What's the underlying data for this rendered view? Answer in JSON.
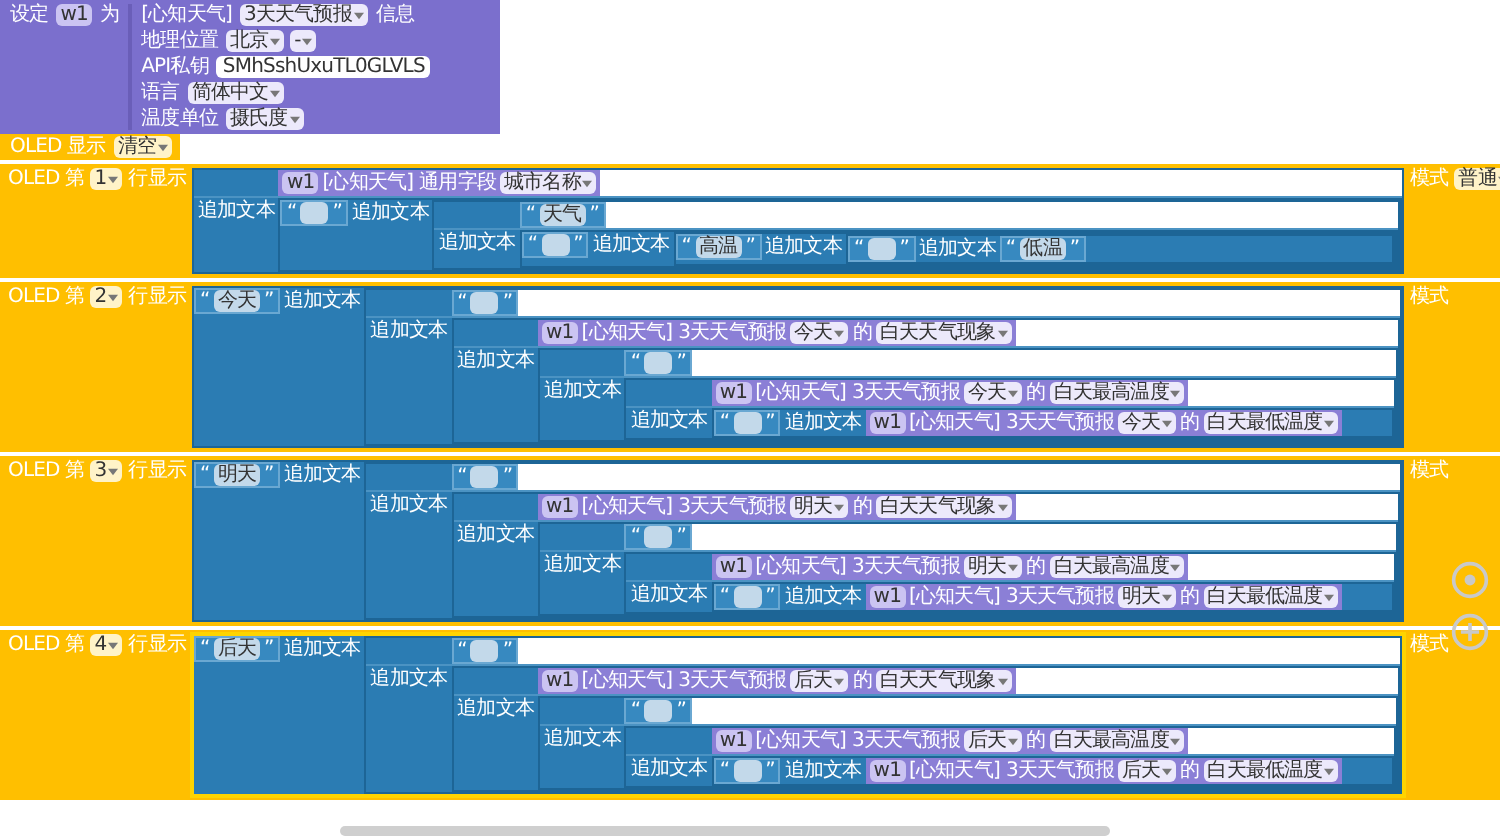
{
  "settings": {
    "set": "设定",
    "var": "w1",
    "as": "为",
    "source": "[心知天气]",
    "name": "3天天气预报",
    "info": "信息",
    "rows": [
      {
        "label": "地理位置",
        "dropdowns": [
          "北京",
          "-"
        ]
      },
      {
        "label": "API私钥",
        "field": "SMhSshUxuTL0GLVLS"
      },
      {
        "label": "语言",
        "dropdowns": [
          "简体中文"
        ]
      },
      {
        "label": "温度单位",
        "dropdowns": [
          "摄氏度"
        ]
      }
    ]
  },
  "oled_clear": {
    "label": "OLED 显示",
    "value": "清空"
  },
  "lines": [
    {
      "prefix": "OLED 第",
      "number": "1",
      "suffix": "行显示",
      "mode_label": "模式",
      "mode": "普通",
      "selected": false,
      "content": {
        "kind": "stack",
        "label": "追加文本",
        "a": {
          "kind": "field",
          "var": "w1",
          "source": "[心知天气]",
          "label": "通用字段",
          "field": "城市名称"
        },
        "b": {
          "kind": "join",
          "label": "追加文本",
          "a": {
            "kind": "text",
            "open": "“",
            "close": "”"
          },
          "b": {
            "kind": "stack",
            "label": "追加文本",
            "a": {
              "kind": "text",
              "open": "“",
              "value": "天气",
              "close": "”"
            },
            "b": {
              "kind": "join",
              "label": "追加文本",
              "a": {
                "kind": "text",
                "open": "“",
                "close": "”"
              },
              "b": {
                "kind": "join",
                "label": "追加文本",
                "a": {
                  "kind": "text",
                  "open": "“",
                  "value": "高温",
                  "close": "”"
                },
                "b": {
                  "kind": "join",
                  "label": "追加文本",
                  "a": {
                    "kind": "text",
                    "open": "“",
                    "close": "”"
                  },
                  "b": {
                    "kind": "text",
                    "open": "“",
                    "value": "低温",
                    "close": "”"
                  }
                }
              }
            }
          }
        }
      }
    },
    {
      "prefix": "OLED 第",
      "number": "2",
      "suffix": "行显示",
      "mode_label": "模式",
      "selected": false,
      "content": {
        "kind": "join",
        "label": "追加文本",
        "a": {
          "kind": "text",
          "open": "“",
          "value": "今天",
          "close": "”"
        },
        "b": {
          "kind": "stack",
          "label": "追加文本",
          "a": {
            "kind": "text",
            "open": "“",
            "close": "”"
          },
          "b": {
            "kind": "stack",
            "label": "追加文本",
            "a": {
              "kind": "weather",
              "var": "w1",
              "source": "[心知天气]",
              "name": "3天天气预报",
              "day": "今天",
              "of": "的",
              "field": "白天天气现象"
            },
            "b": {
              "kind": "stack",
              "label": "追加文本",
              "a": {
                "kind": "text",
                "open": "“",
                "close": "”"
              },
              "b": {
                "kind": "stack",
                "label": "追加文本",
                "a": {
                  "kind": "weather",
                  "var": "w1",
                  "source": "[心知天气]",
                  "name": "3天天气预报",
                  "day": "今天",
                  "of": "的",
                  "field": "白天最高温度"
                },
                "b": {
                  "kind": "join",
                  "label": "追加文本",
                  "a": {
                    "kind": "text",
                    "open": "“",
                    "close": "”"
                  },
                  "b": {
                    "kind": "weather",
                    "var": "w1",
                    "source": "[心知天气]",
                    "name": "3天天气预报",
                    "day": "今天",
                    "of": "的",
                    "field": "白天最低温度"
                  }
                }
              }
            }
          }
        }
      }
    },
    {
      "prefix": "OLED 第",
      "number": "3",
      "suffix": "行显示",
      "mode_label": "模式",
      "selected": false,
      "content": {
        "kind": "join",
        "label": "追加文本",
        "a": {
          "kind": "text",
          "open": "“",
          "value": "明天",
          "close": "”"
        },
        "b": {
          "kind": "stack",
          "label": "追加文本",
          "a": {
            "kind": "text",
            "open": "“",
            "close": "”"
          },
          "b": {
            "kind": "stack",
            "label": "追加文本",
            "a": {
              "kind": "weather",
              "var": "w1",
              "source": "[心知天气]",
              "name": "3天天气预报",
              "day": "明天",
              "of": "的",
              "field": "白天天气现象"
            },
            "b": {
              "kind": "stack",
              "label": "追加文本",
              "a": {
                "kind": "text",
                "open": "“",
                "close": "”"
              },
              "b": {
                "kind": "stack",
                "label": "追加文本",
                "a": {
                  "kind": "weather",
                  "var": "w1",
                  "source": "[心知天气]",
                  "name": "3天天气预报",
                  "day": "明天",
                  "of": "的",
                  "field": "白天最高温度"
                },
                "b": {
                  "kind": "join",
                  "label": "追加文本",
                  "a": {
                    "kind": "text",
                    "open": "“",
                    "close": "”"
                  },
                  "b": {
                    "kind": "weather",
                    "var": "w1",
                    "source": "[心知天气]",
                    "name": "3天天气预报",
                    "day": "明天",
                    "of": "的",
                    "field": "白天最低温度"
                  }
                }
              }
            }
          }
        }
      }
    },
    {
      "prefix": "OLED 第",
      "number": "4",
      "suffix": "行显示",
      "mode_label": "模式",
      "selected": true,
      "content": {
        "kind": "join",
        "label": "追加文本",
        "a": {
          "kind": "text",
          "open": "“",
          "value": "后天",
          "close": "”"
        },
        "b": {
          "kind": "stack",
          "label": "追加文本",
          "a": {
            "kind": "text",
            "open": "“",
            "close": "”"
          },
          "b": {
            "kind": "stack",
            "label": "追加文本",
            "a": {
              "kind": "weather",
              "var": "w1",
              "source": "[心知天气]",
              "name": "3天天气预报",
              "day": "后天",
              "of": "的",
              "field": "白天天气现象"
            },
            "b": {
              "kind": "stack",
              "label": "追加文本",
              "a": {
                "kind": "text",
                "open": "“",
                "close": "”"
              },
              "b": {
                "kind": "stack",
                "label": "追加文本",
                "a": {
                  "kind": "weather",
                  "var": "w1",
                  "source": "[心知天气]",
                  "name": "3天天气预报",
                  "day": "后天",
                  "of": "的",
                  "field": "白天最高温度"
                },
                "b": {
                  "kind": "join",
                  "label": "追加文本",
                  "a": {
                    "kind": "text",
                    "open": "“",
                    "close": "”"
                  },
                  "b": {
                    "kind": "weather",
                    "var": "w1",
                    "source": "[心知天气]",
                    "name": "3天天气预报",
                    "day": "后天",
                    "of": "的",
                    "field": "白天最低温度"
                  }
                }
              }
            }
          }
        }
      }
    }
  ]
}
